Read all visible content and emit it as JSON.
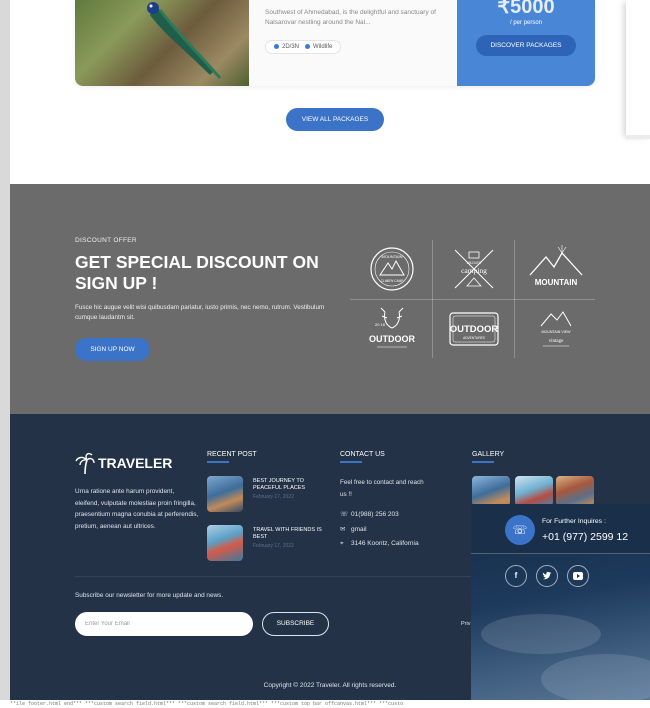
{
  "package_card": {
    "description": "Southwest of Ahmedabad, is the delightful and sanctuary of Nalsarovar nestling around the Nal...",
    "duration": "2D/3N",
    "category": "Wildlife",
    "price": "₹5000",
    "price_unit": "/ per person",
    "discover_label": "DISCOVER PACKAGES"
  },
  "view_all_label": "VIEW ALL PACKAGES",
  "discount": {
    "kicker": "DISCOUNT OFFER",
    "title": "GET SPECIAL DISCOUNT ON SIGN UP !",
    "text": "Fusce hic augue velit wisi quibusdam pariatur, iusto primis, nec nemo, rutrum. Vestibulum cumque laudantm sit.",
    "button": "SIGN UP NOW",
    "logos": [
      {
        "name": "logo-mountain-camp",
        "line1": "MOUNTAIN",
        "line2": "CLIMB'N CAMP"
      },
      {
        "name": "logo-wildlife-camping",
        "line1": "WILDLIFE",
        "line2": "camping"
      },
      {
        "name": "logo-mountain",
        "line1": "MOUNTAIN",
        "line2": ""
      },
      {
        "name": "logo-outdoor-antler",
        "line1": "OUTDOOR",
        "line2": "20 16"
      },
      {
        "name": "logo-outdoor-badge",
        "line1": "OUTDOOR",
        "line2": "ADVENTURES"
      },
      {
        "name": "logo-mountain-view",
        "line1": "MOUNTAIN VIEW",
        "line2": "vintage"
      }
    ]
  },
  "footer": {
    "brand": "TRAVELER",
    "about": "Urna ratione ante harum provident, eleifend, vulputate molestiae proin fringilla, praesentium magna conubia at perferendis, pretium, aenean aut ultrices.",
    "recent_post_heading": "RECENT POST",
    "posts": [
      {
        "title": "BEST JOURNEY TO PEACEFUL PLACES",
        "date": "February 17, 2022"
      },
      {
        "title": "TRAVEL WITH FRIENDS IS BEST",
        "date": "February 17, 2022"
      }
    ],
    "contact_heading": "CONTACT US",
    "contact_intro": "Feel free to contact and reach us !!",
    "phone": "01(988) 256 203",
    "email": "gmail",
    "address": "3146 Koontz, California",
    "gallery_heading": "GALLERY",
    "newsletter_label": "Subscribe our newsletter for more update and news.",
    "email_placeholder": "Enter Your Email",
    "subscribe_label": "SUBSCRIBE",
    "privacy_fragment": "Priv",
    "copyright": "Copyright © 2022 Traveler. All rights reserved."
  },
  "inquiry": {
    "label": "For Further Inquires :",
    "number": "+01 (977) 2599 12"
  },
  "bottom_bar": "**ile footer.html end*** ***custom search field.html*** ***custom search field.html*** ***custom top bar offcanvas.html*** ***custo",
  "colors": {
    "accent": "#3b73c8",
    "footer_bg": "#233247",
    "band_bg": "#6b6b6b"
  }
}
